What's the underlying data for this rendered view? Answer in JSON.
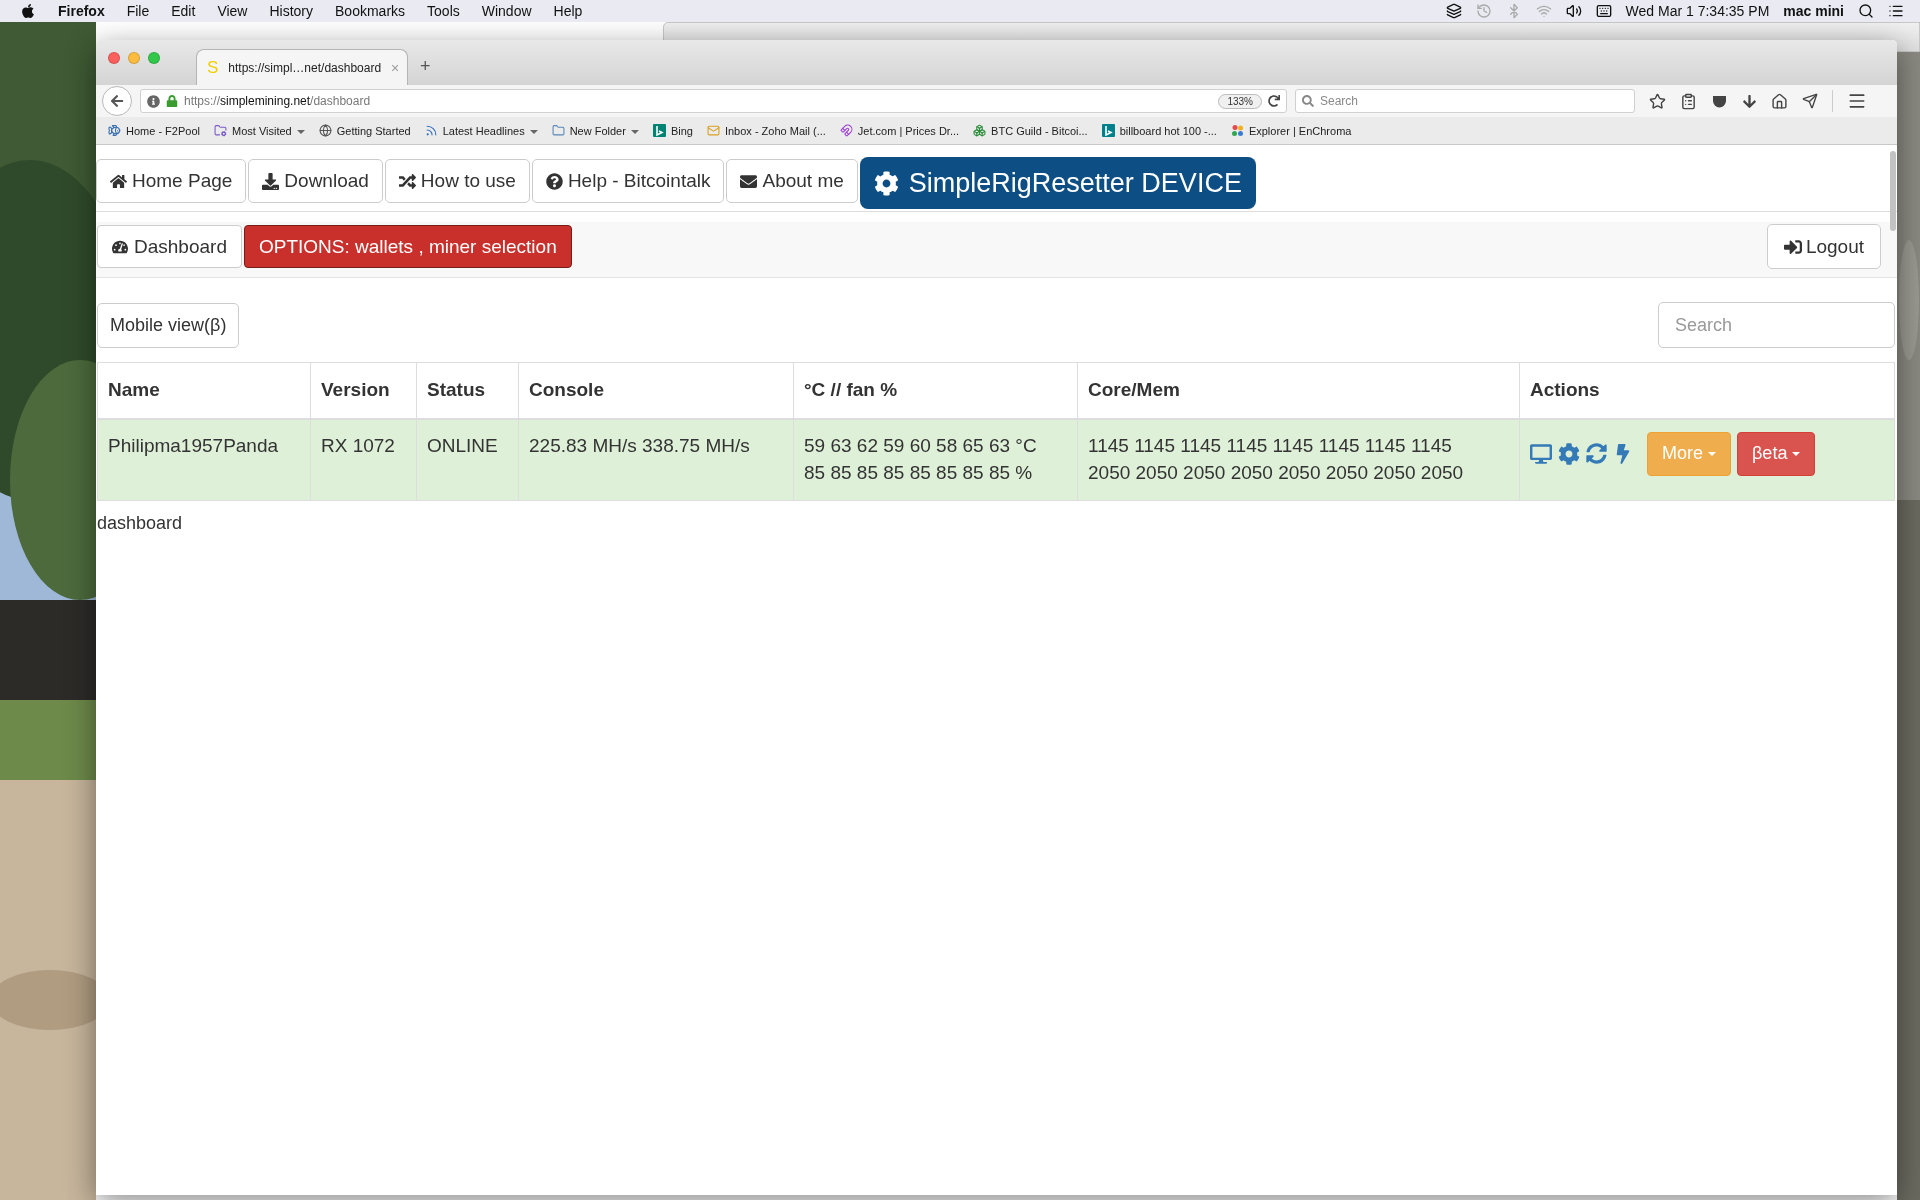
{
  "menu_bar": {
    "app": "Firefox",
    "menus": [
      "File",
      "Edit",
      "View",
      "History",
      "Bookmarks",
      "Tools",
      "Window",
      "Help"
    ],
    "clock": "Wed Mar 1  7:34:35 PM",
    "user": "mac mini"
  },
  "browser": {
    "tab": {
      "favicon": "S",
      "title": "https://simpl…net/dashboard",
      "close": "×"
    },
    "new_tab": "+",
    "url": {
      "scheme": "https://",
      "host": "simplemining.net",
      "path": "/dashboard"
    },
    "zoom": "133%",
    "search_placeholder": "Search",
    "bookmarks": [
      {
        "label": "Home - F2Pool",
        "kind": "link"
      },
      {
        "label": "Most Visited",
        "kind": "folder"
      },
      {
        "label": "Getting Started",
        "kind": "link"
      },
      {
        "label": "Latest Headlines",
        "kind": "folder"
      },
      {
        "label": "New Folder",
        "kind": "folder"
      },
      {
        "label": "Bing",
        "kind": "link"
      },
      {
        "label": "Inbox - Zoho Mail (...",
        "kind": "link"
      },
      {
        "label": "Jet.com | Prices Dr...",
        "kind": "link"
      },
      {
        "label": "BTC Guild - Bitcoi...",
        "kind": "link"
      },
      {
        "label": "billboard hot 100 -...",
        "kind": "link"
      },
      {
        "label": "Explorer | EnChroma",
        "kind": "link"
      }
    ]
  },
  "page": {
    "nav": [
      "Home Page",
      "Download",
      "How to use",
      "Help - Bitcointalk",
      "About me"
    ],
    "brand": "SimpleRigResetter DEVICE",
    "subnav": [
      {
        "label": "Dashboard",
        "kind": "default"
      },
      {
        "label": "OPTIONS: wallets , miner selection",
        "kind": "danger"
      }
    ],
    "logout": "Logout",
    "mobile_view": "Mobile view(β)",
    "search_placeholder": "Search",
    "table": {
      "columns": [
        "Name",
        "Version",
        "Status",
        "Console",
        "°C // fan %",
        "Core/Mem",
        "Actions"
      ],
      "rows": [
        {
          "name": "Philipma1957Panda",
          "version": "RX 1072",
          "status": "ONLINE",
          "console": "225.83 MH/s 338.75 MH/s",
          "temps": [
            "59 63 62 59 60 58 65 63 °C",
            "85 85 85 85 85 85 85 85 %"
          ],
          "clocks": [
            "1145 1145 1145 1145 1145 1145 1145 1145",
            "2050 2050 2050 2050 2050 2050 2050 2050"
          ],
          "actions": [
            {
              "label": "More",
              "kind": "warning"
            },
            {
              "label": "βeta",
              "kind": "danger"
            }
          ]
        }
      ]
    },
    "footer": "dashboard"
  }
}
